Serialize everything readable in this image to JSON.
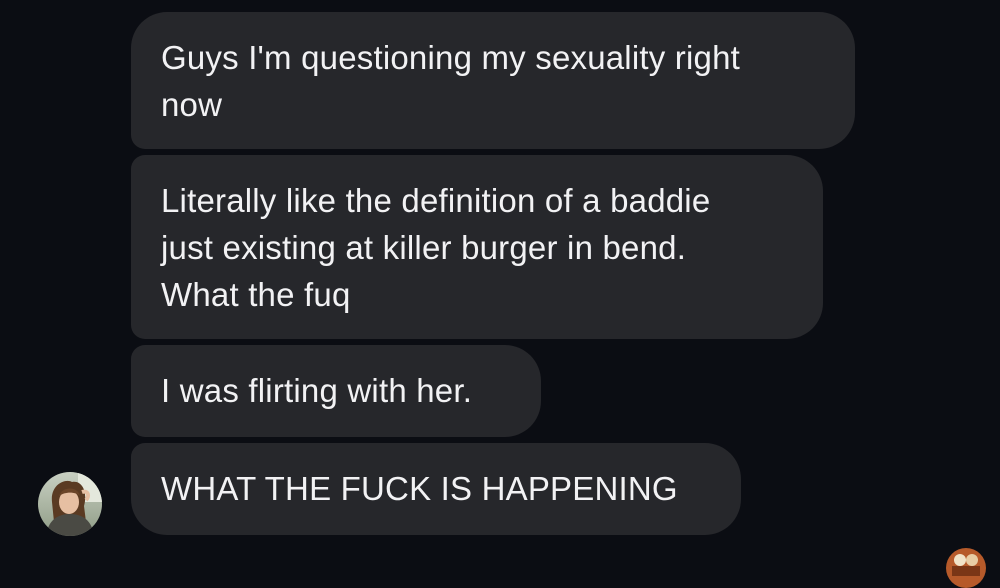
{
  "messages": [
    {
      "text": "Guys I'm questioning my sexuality right\nnow"
    },
    {
      "text": "Literally like the definition of a baddie\njust existing at killer burger in bend.\nWhat the fuq"
    },
    {
      "text": "I was flirting with her."
    },
    {
      "text": "WHAT THE FUCK IS HAPPENING"
    }
  ],
  "sender": {
    "avatar_icon": "user-avatar-photo"
  },
  "colors": {
    "background": "#0b0d13",
    "bubble": "#26272b",
    "text": "#f2f2f4"
  }
}
